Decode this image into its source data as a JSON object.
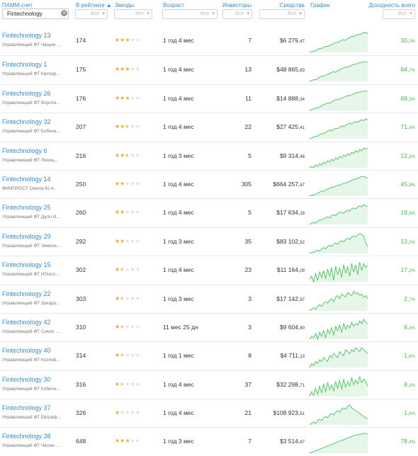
{
  "header": {
    "account_label": "ПАММ-счет",
    "rating_label": "В рейтинге ▲",
    "stars_label": "Звезды",
    "age_label": "Возраст",
    "investors_label": "Инвесторы",
    "funds_label": "Средства",
    "chart_label": "График",
    "yield_label": "Доходность всего",
    "search_value": "Fintechnology",
    "filter_value": "Все"
  },
  "rows": [
    {
      "name": "Fintechnology 13",
      "manager": "Управляющий ФТ Чащин ...",
      "rank": "174",
      "stars": 3,
      "age": "1 год 4 мес",
      "investors": "7",
      "funds_main": "$6 279,",
      "funds_cents": "47",
      "yield_main": "30,",
      "yield_dec": "0%",
      "trend": [
        2,
        3,
        3,
        4,
        5,
        6,
        6,
        7,
        8,
        8,
        9,
        10,
        11,
        12,
        12,
        13,
        14,
        15,
        14,
        16,
        17,
        18,
        18,
        19,
        20,
        20,
        21,
        22,
        22,
        21
      ]
    },
    {
      "name": "Fintechnology 1",
      "manager": "Управляющий ФТ Каспар...",
      "rank": "175",
      "stars": 3,
      "age": "1 год 4 мес",
      "investors": "13",
      "funds_main": "$48 865,",
      "funds_cents": "83",
      "yield_main": "64,",
      "yield_dec": "7%",
      "trend": [
        2,
        3,
        4,
        4,
        5,
        7,
        8,
        8,
        9,
        10,
        11,
        12,
        13,
        12,
        14,
        15,
        16,
        17,
        18,
        18,
        19,
        20,
        21,
        21,
        22,
        23,
        23,
        24,
        24,
        23
      ]
    },
    {
      "name": "Fintechnology 26",
      "manager": "Управляющий ФТ Воротя...",
      "rank": "176",
      "stars": 3,
      "age": "1 год 4 мес",
      "investors": "11",
      "funds_main": "$14 888,",
      "funds_cents": "34",
      "yield_main": "69,",
      "yield_dec": "3%",
      "trend": [
        2,
        3,
        4,
        5,
        5,
        6,
        8,
        9,
        10,
        11,
        11,
        12,
        14,
        15,
        15,
        16,
        17,
        18,
        19,
        20,
        20,
        21,
        22,
        23,
        24,
        24,
        25,
        25,
        26,
        25
      ]
    },
    {
      "name": "Fintechnology 32",
      "manager": "Управляющий ФТ Бобенк...",
      "rank": "207",
      "stars": 2.5,
      "age": "1 год 4 мес",
      "investors": "22",
      "funds_main": "$27 425,",
      "funds_cents": "41",
      "yield_main": "71,",
      "yield_dec": "8%",
      "trend": [
        3,
        4,
        5,
        6,
        6,
        8,
        9,
        9,
        10,
        12,
        13,
        12,
        14,
        15,
        15,
        16,
        18,
        17,
        19,
        20,
        21,
        20,
        22,
        23,
        22,
        24,
        25,
        24,
        26,
        25
      ]
    },
    {
      "name": "Fintechnology 6",
      "manager": "Управляющий ФТ Лисиц...",
      "rank": "216",
      "stars": 2.5,
      "age": "1 год 3 мес",
      "investors": "5",
      "funds_main": "$9 314,",
      "funds_cents": "46",
      "yield_main": "12,",
      "yield_dec": "5%",
      "trend": [
        8,
        9,
        8,
        10,
        9,
        11,
        10,
        12,
        11,
        13,
        12,
        14,
        13,
        15,
        14,
        16,
        15,
        17,
        16,
        18,
        17,
        19,
        18,
        20,
        19,
        21,
        20,
        22,
        21,
        22
      ]
    },
    {
      "name": "Fintechnology 14",
      "manager": "ФИНПРОСТ Смола Ю.А.",
      "rank": "250",
      "stars": 2,
      "age": "1 год 4 мес",
      "investors": "305",
      "funds_main": "$664 257,",
      "funds_cents": "47",
      "yield_main": "45,",
      "yield_dec": "9%",
      "trend": [
        2,
        3,
        3,
        4,
        5,
        6,
        7,
        7,
        8,
        9,
        10,
        11,
        11,
        12,
        13,
        13,
        14,
        15,
        15,
        16,
        17,
        18,
        19,
        19,
        20,
        21,
        22,
        22,
        21,
        20
      ]
    },
    {
      "name": "Fintechnology 25",
      "manager": "Управляющий ФТ Дуло И...",
      "rank": "260",
      "stars": 2,
      "age": "1 год 4 мес",
      "investors": "5",
      "funds_main": "$17 634,",
      "funds_cents": "18",
      "yield_main": "19,",
      "yield_dec": "6%",
      "trend": [
        4,
        5,
        6,
        5,
        7,
        8,
        8,
        9,
        10,
        11,
        10,
        12,
        13,
        12,
        14,
        15,
        15,
        14,
        16,
        17,
        16,
        18,
        19,
        18,
        20,
        21,
        20,
        22,
        21,
        20
      ]
    },
    {
      "name": "Fintechnology 29",
      "manager": "Управляющий ФТ Зимнох...",
      "rank": "292",
      "stars": 2,
      "age": "1 год 3 мес",
      "investors": "35",
      "funds_main": "$83 102,",
      "funds_cents": "52",
      "yield_main": "13,",
      "yield_dec": "0%",
      "trend": [
        6,
        7,
        7,
        8,
        9,
        8,
        10,
        11,
        10,
        12,
        13,
        12,
        14,
        15,
        14,
        16,
        17,
        16,
        18,
        19,
        18,
        20,
        21,
        20,
        22,
        23,
        22,
        21,
        15,
        12
      ]
    },
    {
      "name": "Fintechnology 15",
      "manager": "Управляющий ФТ НПосл...",
      "rank": "302",
      "stars": 1.5,
      "age": "1 год 4 мес",
      "investors": "23",
      "funds_main": "$11 164,",
      "funds_cents": "09",
      "yield_main": "17,",
      "yield_dec": "2%",
      "trend": [
        10,
        12,
        8,
        14,
        9,
        15,
        11,
        16,
        10,
        17,
        12,
        18,
        9,
        19,
        13,
        18,
        11,
        20,
        14,
        19,
        12,
        21,
        15,
        20,
        13,
        22,
        16,
        21,
        18,
        20
      ]
    },
    {
      "name": "Fintechnology 22",
      "manager": "Управляющий ФТ Захаро...",
      "rank": "303",
      "stars": 1.5,
      "age": "1 год 3 мес",
      "investors": "3",
      "funds_main": "$17 142,",
      "funds_cents": "97",
      "yield_main": "2,",
      "yield_dec": "7%",
      "trend": [
        10,
        11,
        12,
        11,
        13,
        14,
        13,
        15,
        16,
        15,
        17,
        18,
        16,
        19,
        20,
        18,
        21,
        20,
        19,
        22,
        21,
        20,
        23,
        21,
        22,
        20,
        21,
        19,
        20,
        18
      ]
    },
    {
      "name": "Fintechnology 42",
      "manager": "Управляющий ФТ Сокол ...",
      "rank": "310",
      "stars": 1.5,
      "age": "11 мес 25 дн",
      "investors": "3",
      "funds_main": "$9 604,",
      "funds_cents": "80",
      "yield_main": "6,",
      "yield_dec": "4%",
      "trend": [
        8,
        10,
        9,
        12,
        8,
        13,
        10,
        14,
        9,
        15,
        12,
        16,
        11,
        17,
        14,
        18,
        13,
        19,
        15,
        18,
        16,
        20,
        17,
        19,
        18,
        21,
        19,
        22,
        20,
        19
      ]
    },
    {
      "name": "Fintechnology 40",
      "manager": "Управляющий ФТ Козлов...",
      "rank": "314",
      "stars": 1.5,
      "age": "1 год 1 мес",
      "investors": "8",
      "funds_main": "$4 711,",
      "funds_cents": "13",
      "yield_main": "1,",
      "yield_dec": "6%",
      "trend": [
        9,
        11,
        10,
        12,
        11,
        13,
        12,
        14,
        13,
        12,
        15,
        14,
        16,
        15,
        14,
        17,
        16,
        15,
        18,
        17,
        16,
        18,
        17,
        19,
        18,
        17,
        19,
        18,
        17,
        16
      ]
    },
    {
      "name": "Fintechnology 30",
      "manager": "Управляющий ФТ Кобеле...",
      "rank": "316",
      "stars": 1.5,
      "age": "1 год 4 мес",
      "investors": "37",
      "funds_main": "$32 298,",
      "funds_cents": "71",
      "yield_main": "8,",
      "yield_dec": "3%",
      "trend": [
        6,
        10,
        7,
        13,
        8,
        15,
        9,
        17,
        10,
        18,
        12,
        16,
        11,
        19,
        13,
        20,
        12,
        21,
        14,
        19,
        15,
        22,
        16,
        20,
        17,
        23,
        18,
        21,
        19,
        15
      ]
    },
    {
      "name": "Fintechnology 37",
      "manager": "Управляющий ФТ Евграф...",
      "rank": "326",
      "stars": 1,
      "age": "1 год 4 мес",
      "investors": "21",
      "funds_main": "$108 923,",
      "funds_cents": "51",
      "yield_main": "1,",
      "yield_dec": "6%",
      "trend": [
        8,
        9,
        10,
        9,
        11,
        12,
        11,
        13,
        14,
        13,
        15,
        16,
        15,
        17,
        18,
        17,
        19,
        20,
        19,
        21,
        22,
        20,
        19,
        18,
        17,
        16,
        15,
        14,
        13,
        12
      ]
    },
    {
      "name": "Fintechnology 38",
      "manager": "Управляющий ФТ Чалин ...",
      "rank": "648",
      "stars": 3,
      "age": "1 год 3 мес",
      "investors": "7",
      "funds_main": "$3 514,",
      "funds_cents": "67",
      "yield_main": "78,",
      "yield_dec": "4%",
      "trend": [
        2,
        3,
        4,
        5,
        6,
        7,
        8,
        9,
        10,
        11,
        12,
        13,
        14,
        15,
        16,
        17,
        18,
        19,
        20,
        21,
        22,
        23,
        24,
        25,
        25,
        26,
        26,
        27,
        27,
        26
      ]
    }
  ],
  "colors": {
    "accent": "#3a8ac8",
    "positive": "#4caf50",
    "chart_line": "#5cc26c",
    "chart_fill": "#e6f6e8",
    "star": "#f0a830"
  }
}
